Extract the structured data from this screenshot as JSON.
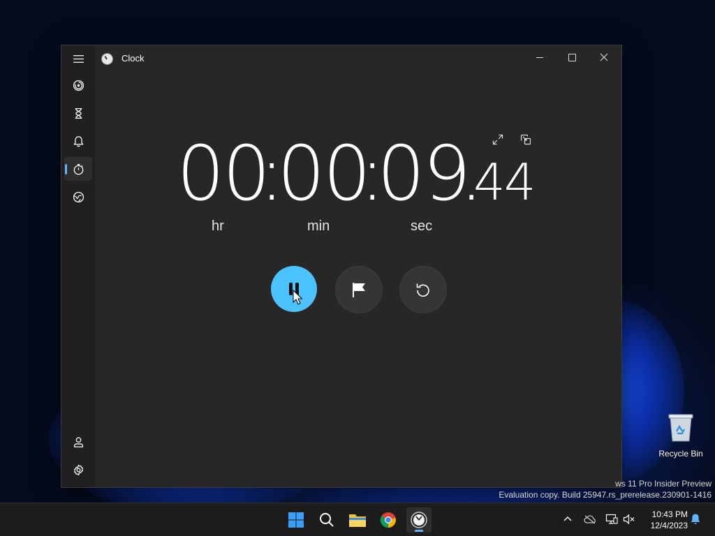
{
  "app": {
    "title": "Clock",
    "icon": "clock-app-icon"
  },
  "window_controls": {
    "minimize": "minimize-icon",
    "maximize": "maximize-icon",
    "close": "close-icon"
  },
  "sidebar": {
    "items": [
      {
        "name": "menu",
        "icon": "hamburger-icon"
      },
      {
        "name": "focus-sessions",
        "icon": "focus-icon"
      },
      {
        "name": "timer",
        "icon": "hourglass-icon"
      },
      {
        "name": "alarm",
        "icon": "bell-icon"
      },
      {
        "name": "stopwatch",
        "icon": "stopwatch-icon",
        "active": true
      },
      {
        "name": "world-clock",
        "icon": "globe-icon"
      },
      {
        "name": "account",
        "icon": "person-icon"
      },
      {
        "name": "settings",
        "icon": "gear-icon"
      }
    ]
  },
  "stopwatch": {
    "hours": "00",
    "minutes": "00",
    "seconds": "09",
    "separator": ":",
    "decimal": ".",
    "centiseconds": "44",
    "labels": {
      "hr": "hr",
      "min": "min",
      "sec": "sec"
    },
    "accent_color": "#4cc2ff"
  },
  "desktop": {
    "recycle_bin_label": "Recycle Bin",
    "watermark_line1": "ws 11 Pro Insider Preview",
    "watermark_line2": "Evaluation copy. Build 25947.rs_prerelease.230901-1416"
  },
  "taskbar": {
    "time": "10:43 PM",
    "date": "12/4/2023"
  }
}
